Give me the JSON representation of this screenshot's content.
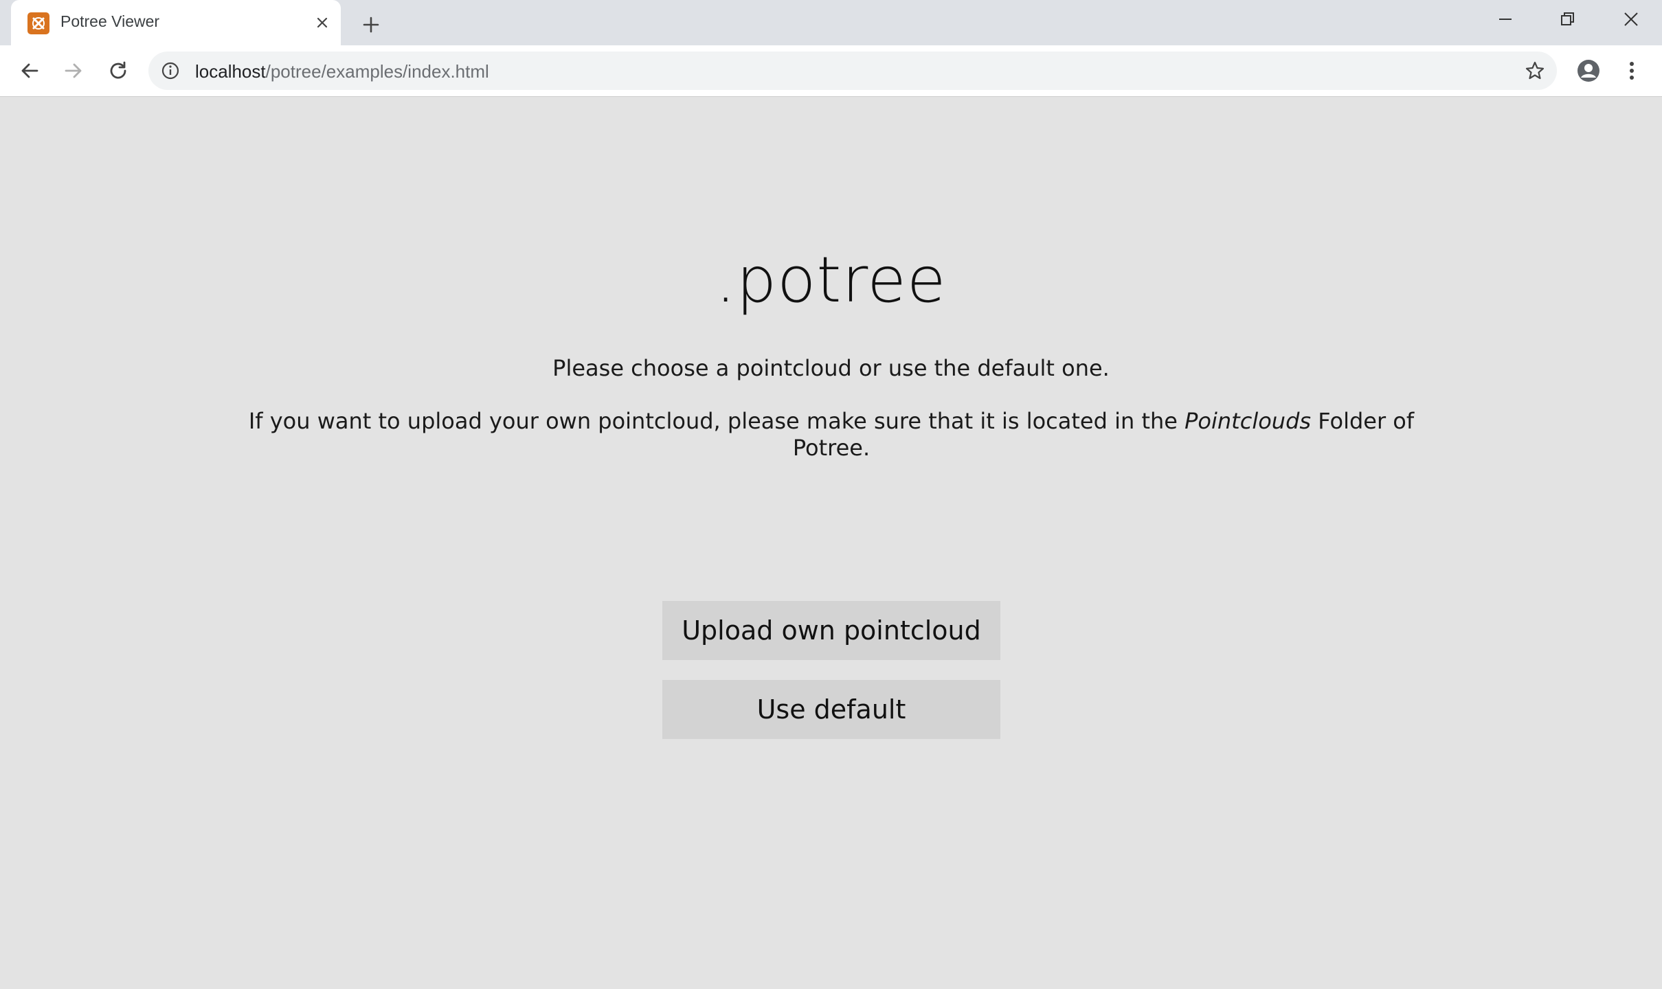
{
  "browser": {
    "tab": {
      "title": "Potree Viewer",
      "favicon": "xampp-icon"
    },
    "address_bar": {
      "host": "localhost",
      "path": "/potree/examples/index.html"
    },
    "icons": {
      "back": "arrow-left-icon",
      "forward": "arrow-right-icon",
      "reload": "reload-icon",
      "info": "info-icon",
      "bookmark": "star-icon",
      "profile": "account-icon",
      "menu": "kebab-menu-icon"
    }
  },
  "page": {
    "title": ".potree",
    "intro": "Please choose a pointcloud or use the default one.",
    "instructions": {
      "before": "If you want to upload your own pointcloud, please make sure that it is located in the ",
      "emphasis": "Pointclouds",
      "after": " Folder of Potree."
    },
    "buttons": {
      "upload": "Upload own pointcloud",
      "default": "Use default"
    }
  },
  "colors": {
    "page_background": "#e3e3e3",
    "button_background": "#d3d3d3",
    "favicon": "#d9731f"
  }
}
